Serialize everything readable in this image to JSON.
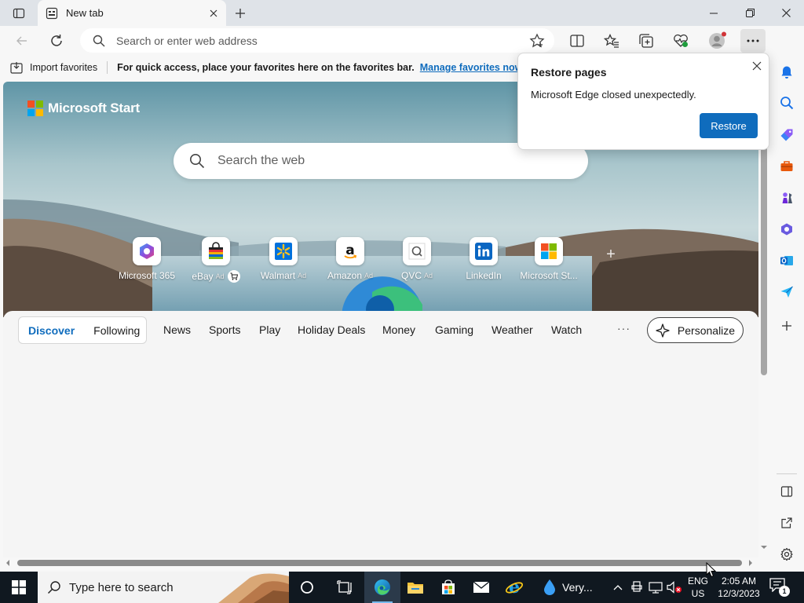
{
  "tab": {
    "title": "New tab"
  },
  "omnibox": {
    "placeholder": "Search or enter web address"
  },
  "favorites_bar": {
    "import_label": "Import favorites",
    "message": "For quick access, place your favorites here on the favorites bar.",
    "link": "Manage favorites now"
  },
  "restore_popup": {
    "title": "Restore pages",
    "message": "Microsoft Edge closed unexpectedly.",
    "button": "Restore"
  },
  "ntp": {
    "brand": "Microsoft Start",
    "search_placeholder": "Search the web",
    "quick_links": [
      {
        "label": "Microsoft 365",
        "ad": "",
        "icon": "microsoft-365-icon"
      },
      {
        "label": "eBay",
        "ad": "Ad",
        "icon": "ebay-icon"
      },
      {
        "label": "Walmart",
        "ad": "Ad",
        "icon": "walmart-icon"
      },
      {
        "label": "Amazon",
        "ad": "Ad",
        "icon": "amazon-icon"
      },
      {
        "label": "QVC",
        "ad": "Ad",
        "icon": "qvc-icon"
      },
      {
        "label": "LinkedIn",
        "ad": "",
        "icon": "linkedin-icon"
      },
      {
        "label": "Microsoft St...",
        "ad": "",
        "icon": "microsoft-store-icon"
      }
    ],
    "feed_tabs": {
      "discover": "Discover",
      "following": "Following",
      "items": [
        "News",
        "Sports",
        "Play",
        "Holiday Deals",
        "Money",
        "Gaming",
        "Weather",
        "Watch"
      ],
      "more": "···",
      "personalize": "Personalize"
    }
  },
  "taskbar": {
    "search_placeholder": "Type here to search",
    "weather": "Very...",
    "language": [
      "ENG",
      "US"
    ],
    "time": "2:05 AM",
    "date": "12/3/2023",
    "notification_count": "1"
  },
  "colors": {
    "accent": "#0f6cbd",
    "taskbar": "#101820",
    "chrome": "#dfe3e8"
  }
}
